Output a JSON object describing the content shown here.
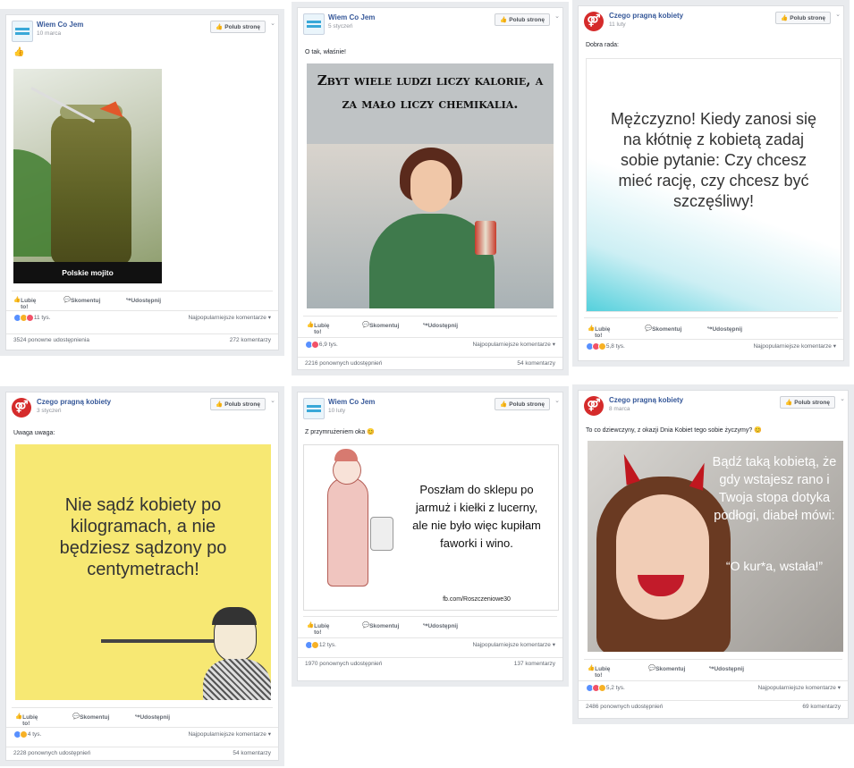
{
  "posts": [
    {
      "page": "Wiem Co Jem",
      "date": "10 marca",
      "like_page": "Polub stronę",
      "caption": "👍",
      "image_text": "Polskie mojito",
      "actions": {
        "like": "Lubię to!",
        "comment": "Skomentuj",
        "share": "Udostępnij"
      },
      "reactions": "11 tys.",
      "sort": "Najpopularniejsze komentarze ▾",
      "shares": "3524 ponowne udostępnienia",
      "comments": "272 komentarzy"
    },
    {
      "page": "Wiem Co Jem",
      "date": "5 styczeń",
      "like_page": "Polub stronę",
      "caption": "O tak, właśnie!",
      "image_text": "Zbyt wiele ludzi liczy kalorie, a za mało liczy chemikalia.",
      "actions": {
        "like": "Lubię to!",
        "comment": "Skomentuj",
        "share": "Udostępnij"
      },
      "reactions": "6,9 tys.",
      "sort": "Najpopularniejsze komentarze ▾",
      "shares": "2216 ponownych udostępnień",
      "comments": "54 komentarzy"
    },
    {
      "page": "Czego pragną kobiety",
      "date": "11 luty",
      "like_page": "Polub stronę",
      "caption": "Dobra rada:",
      "image_text": "Mężczyzno! Kiedy zanosi się na kłótnię z kobietą zadaj sobie pytanie: Czy chcesz mieć rację, czy chcesz być szczęśliwy!",
      "actions": {
        "like": "Lubię to!",
        "comment": "Skomentuj",
        "share": "Udostępnij"
      },
      "reactions": "5,8 tys.",
      "sort": "Najpopularniejsze komentarze ▾",
      "shares": "",
      "comments": ""
    },
    {
      "page": "Czego pragną kobiety",
      "date": "3 styczeń",
      "like_page": "Polub stronę",
      "caption": "Uwaga uwaga:",
      "image_text": "Nie sądź kobiety po kilogramach, a nie będziesz sądzony po centymetrach!",
      "actions": {
        "like": "Lubię to!",
        "comment": "Skomentuj",
        "share": "Udostępnij"
      },
      "reactions": "4 tys.",
      "sort": "Najpopularniejsze komentarze ▾",
      "shares": "2228 ponownych udostępnień",
      "comments": "54 komentarzy"
    },
    {
      "page": "Wiem Co Jem",
      "date": "10 luty",
      "like_page": "Polub stronę",
      "caption": "Z przymrużeniem oka 😊",
      "image_text": "Poszłam do sklepu po jarmuż i kiełki z lucerny, ale nie było więc kupiłam faworki i wino.",
      "image_credit": "fb.com/Roszczeniowe30",
      "actions": {
        "like": "Lubię to!",
        "comment": "Skomentuj",
        "share": "Udostępnij"
      },
      "reactions": "12 tys.",
      "sort": "Najpopularniejsze komentarze ▾",
      "shares": "1970 ponownych udostępnień",
      "comments": "137 komentarzy"
    },
    {
      "page": "Czego pragną kobiety",
      "date": "8 marca",
      "like_page": "Polub stronę",
      "caption": "To co dziewczyny, z okazji Dnia Kobiet tego sobie życzymy? 😊",
      "image_text": "Bądź taką kobietą, że gdy wstajesz rano i Twoja stopa dotyka podłogi, diabeł mówi:",
      "image_quote": "“O kur*a, wstała!”",
      "actions": {
        "like": "Lubię to!",
        "comment": "Skomentuj",
        "share": "Udostępnij"
      },
      "reactions": "5,2 tys.",
      "sort": "Najpopularniejsze komentarze ▾",
      "shares": "2486 ponownych udostępnień",
      "comments": "69 komentarzy"
    }
  ],
  "colors": {
    "fb_blue": "#365899",
    "like": "#5890ff",
    "love": "#f25268",
    "haha": "#f7b125"
  }
}
